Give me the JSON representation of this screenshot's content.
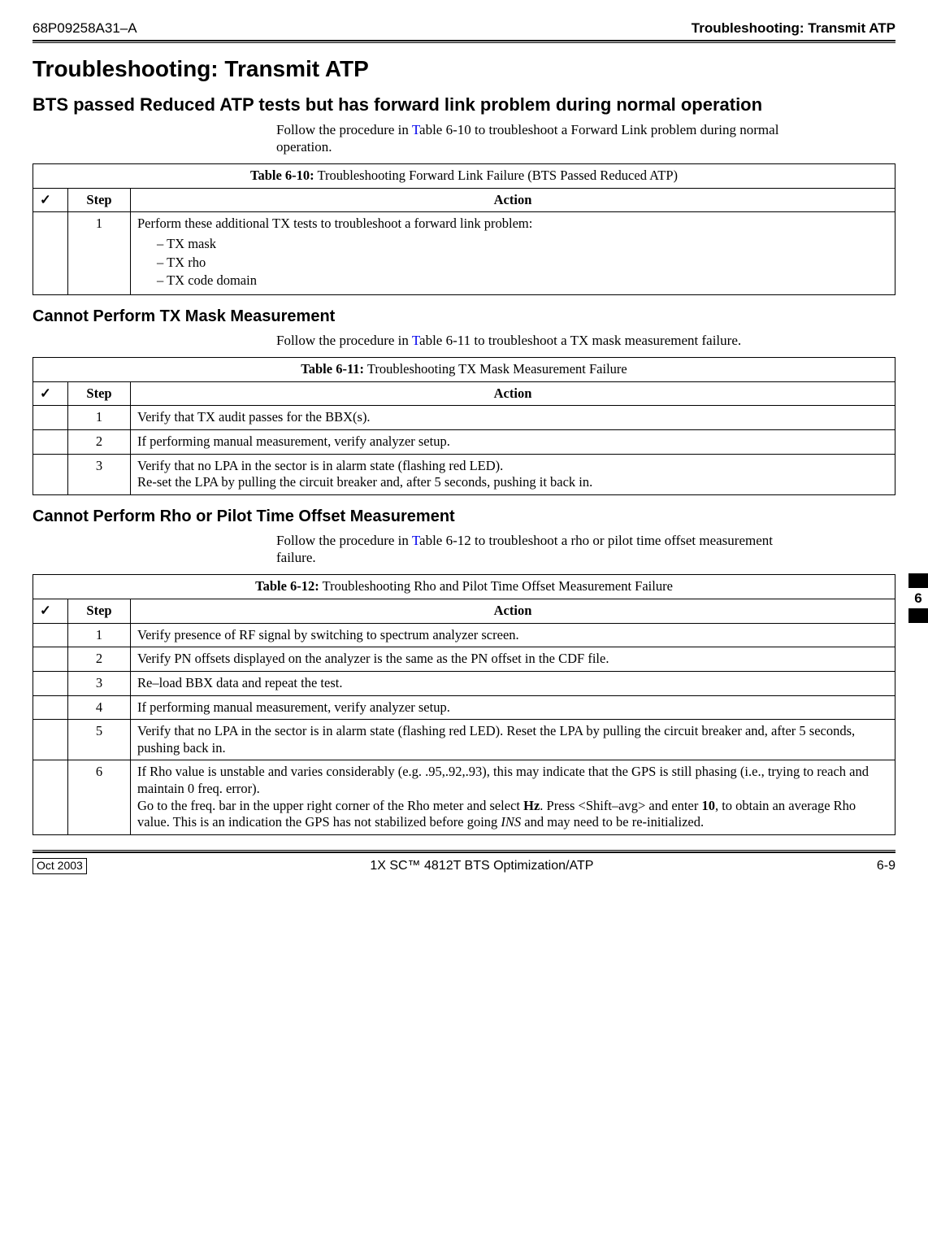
{
  "header": {
    "doc_id": "68P09258A31–A",
    "top_title": "Troubleshooting: Transmit ATP"
  },
  "page_title": "Troubleshooting: Transmit ATP",
  "section1": {
    "heading": "BTS passed Reduced ATP tests but has forward link problem during normal operation",
    "para_pre": "Follow the procedure in ",
    "para_link": "T",
    "para_post": "able 6-10 to troubleshoot a Forward Link problem during normal operation.",
    "table": {
      "caption_strong": "Table 6-10:",
      "caption_rest": " Troubleshooting Forward Link Failure (BTS Passed Reduced ATP)",
      "check_h": "✓",
      "step_h": "Step",
      "action_h": "Action",
      "r1_step": "1",
      "r1_action": "Perform these additional TX tests to troubleshoot a forward link problem:",
      "r1_li1": "TX mask",
      "r1_li2": "TX rho",
      "r1_li3": "TX code domain"
    }
  },
  "section2": {
    "heading": "Cannot Perform TX Mask Measurement",
    "para_pre": "Follow the procedure in ",
    "para_link": "T",
    "para_post": "able 6-11 to troubleshoot a TX mask measurement failure.",
    "table": {
      "caption_strong": "Table 6-11:",
      "caption_rest": " Troubleshooting TX Mask Measurement Failure",
      "check_h": "✓",
      "step_h": "Step",
      "action_h": "Action",
      "r1_step": "1",
      "r1_action": "Verify that TX audit passes for the BBX(s).",
      "r2_step": "2",
      "r2_action": "If performing manual measurement, verify analyzer setup.",
      "r3_step": "3",
      "r3_action": "Verify that no LPA in the sector is in alarm state (flashing red LED).\nRe-set the LPA by pulling the circuit breaker and, after 5 seconds, pushing it back in."
    }
  },
  "section3": {
    "heading": "Cannot Perform Rho or Pilot Time Offset Measurement",
    "para_pre": "Follow the procedure in ",
    "para_link": "T",
    "para_post": "able 6-12 to troubleshoot a rho or pilot time offset measurement failure.",
    "table": {
      "caption_strong": "Table 6-12:",
      "caption_rest": " Troubleshooting Rho and Pilot Time Offset Measurement Failure",
      "check_h": "✓",
      "step_h": "Step",
      "action_h": "Action",
      "r1_step": "1",
      "r1_action": "Verify presence of RF signal by switching to spectrum analyzer screen.",
      "r2_step": "2",
      "r2_action": "Verify PN offsets displayed on the analyzer is the same as the PN offset in the CDF file.",
      "r3_step": "3",
      "r3_action": "Re–load BBX data and repeat the test.",
      "r4_step": "4",
      "r4_action": "If performing manual measurement, verify analyzer setup.",
      "r5_step": "5",
      "r5_action": "Verify that no LPA in the sector is in alarm state (flashing red LED). Reset the LPA by pulling the circuit breaker and, after 5 seconds, pushing back in.",
      "r6_step": "6",
      "r6_line1": "If Rho value is unstable and varies considerably (e.g. .95,.92,.93), this may indicate that the GPS is still phasing (i.e., trying to reach and maintain 0 freq. error).",
      "r6_line2a": "Go to the freq. bar in the upper right corner of the Rho meter and select ",
      "r6_hz": "Hz",
      "r6_line2b": ". Press <Shift–avg> and enter ",
      "r6_ten": "10",
      "r6_line2c": ", to obtain an average Rho value. This is an indication the GPS has not stabilized before going ",
      "r6_ins": "INS",
      "r6_line2d": " and may need to be re-initialized."
    }
  },
  "edge_tab": "6",
  "footer": {
    "date": "Oct 2003",
    "center": "1X SC™ 4812T BTS Optimization/ATP",
    "page": "6-9"
  }
}
